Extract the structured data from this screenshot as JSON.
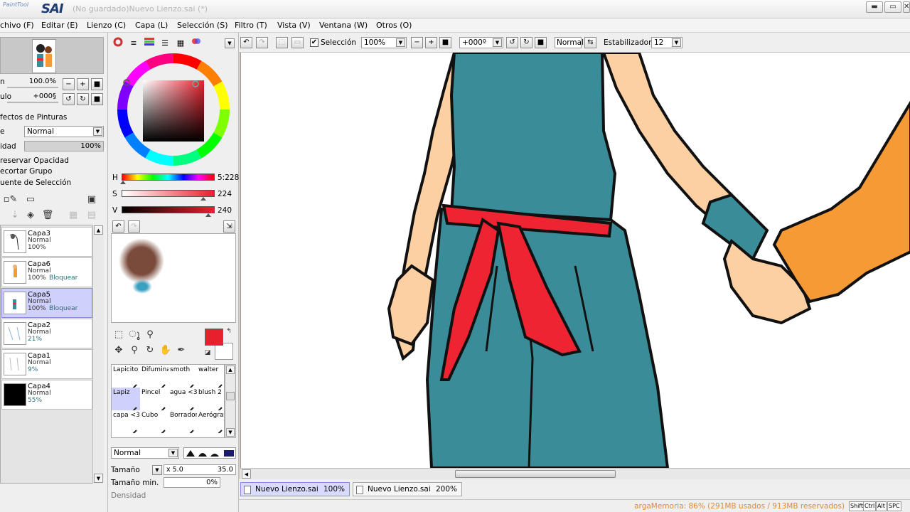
{
  "app": {
    "logo_small": "PaintTool",
    "logo_big": "SAI",
    "title": "(No guardado)Nuevo Lienzo.sai (*)"
  },
  "window_buttons": {
    "minimize": "▬",
    "maximize": "▭",
    "close": "✕"
  },
  "menu": [
    "chivo (F)",
    "Editar (E)",
    "Lienzo (C)",
    "Capa (L)",
    "Selección (S)",
    "Filtro (T)",
    "Vista (V)",
    "Ventana (W)",
    "Otros (O)"
  ],
  "navigator": {
    "zoom_label": "n",
    "zoom_value": "100.0%",
    "angle_label": "ulo",
    "angle_value": "+000§"
  },
  "layer_props": {
    "effects_label": "fectos de Pinturas",
    "mode_label": "e",
    "mode_value": "Normal",
    "opacity_label": "idad",
    "opacity_value": "100%",
    "preserve_opacity": "reservar Opacidad",
    "clip_group": "ecortar Grupo",
    "selection_source": "uente de Selección"
  },
  "layers": [
    {
      "name": "Capa3",
      "mode": "Normal",
      "opacity": "100%",
      "lock": "",
      "active": false
    },
    {
      "name": "Capa6",
      "mode": "Normal",
      "opacity": "100%",
      "lock": "Bloquear",
      "active": false
    },
    {
      "name": "Capa5",
      "mode": "Normal",
      "opacity": "100%",
      "lock": "Bloquear",
      "active": true
    },
    {
      "name": "Capa2",
      "mode": "Normal",
      "opacity": "21%",
      "lock": "",
      "active": false
    },
    {
      "name": "Capa1",
      "mode": "Normal",
      "opacity": "9%",
      "lock": "",
      "active": false
    },
    {
      "name": "Capa4",
      "mode": "Normal",
      "opacity": "55%",
      "lock": "",
      "active": false
    }
  ],
  "color": {
    "h_label": "H",
    "h_value": "5:228",
    "h_level": 0.01,
    "s_label": "S",
    "s_value": "224",
    "s_level": 0.88,
    "v_label": "V",
    "v_value": "240",
    "v_level": 0.94,
    "primary": "#e8202e",
    "secondary": "#ffffff"
  },
  "brushes": [
    {
      "name": "Lapicito",
      "active": false
    },
    {
      "name": "Difumina",
      "active": false
    },
    {
      "name": "smoth",
      "active": false
    },
    {
      "name": "walter",
      "active": false
    },
    {
      "name": "Lapiz",
      "active": true
    },
    {
      "name": "Pincel",
      "active": false
    },
    {
      "name": "agua <3",
      "active": false
    },
    {
      "name": "blush 2",
      "active": false
    },
    {
      "name": "capa <3",
      "active": false
    },
    {
      "name": "Cubo",
      "active": false
    },
    {
      "name": "Borrador",
      "active": false
    },
    {
      "name": "Aerógraf",
      "active": false
    }
  ],
  "brush_settings": {
    "mode_value": "Normal",
    "size_label": "Tamaño",
    "size_mult": "x 5.0",
    "size_value": "35.0",
    "min_size_label": "Tamaño min.",
    "min_size_value": "0%",
    "density_label": "Densidad"
  },
  "toolbar": {
    "selection_label": "Selección",
    "zoom_value": "100%",
    "rotation_value": "+000º",
    "mode_value": "Normal",
    "stabilizer_label": "Estabilizador",
    "stabilizer_value": "12"
  },
  "doc_tabs": [
    {
      "name": "Nuevo Lienzo.sai",
      "zoom": "100%",
      "active": true
    },
    {
      "name": "Nuevo Lienzo.sai",
      "zoom": "200%",
      "active": false
    }
  ],
  "status": {
    "memory": "argaMemoria: 86% (291MB usados / 913MB reservados)",
    "keys": [
      "Shift",
      "Ctrl",
      "Alt",
      "SPC"
    ]
  },
  "colors": {
    "skin": "#fcd0a2",
    "shirt": "#3a8c98",
    "sash": "#ee2433",
    "sleeve": "#f59a34",
    "outline": "#111111"
  }
}
